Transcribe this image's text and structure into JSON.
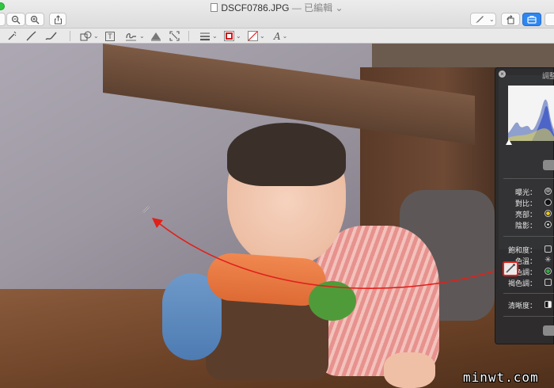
{
  "window": {
    "filename": "DSCF0786.JPG",
    "status": "— 已編輯",
    "status_caret": "⌄"
  },
  "toolbar": {
    "zoom_out_icon": "zoom-out-icon",
    "zoom_in_icon": "zoom-in-icon",
    "share_icon": "share-icon",
    "pen_icon": "pen-icon",
    "rotate_icon": "rotate-icon",
    "markup_toolbox_icon": "toolbox-icon",
    "caret": "⌄"
  },
  "markup": {
    "tools": [
      "select-icon",
      "sketch-icon",
      "draw-icon",
      "shapes-icon",
      "text-icon",
      "sign-icon",
      "adjust-color-icon",
      "adjust-size-icon",
      "line-style-icon",
      "border-color-icon",
      "fill-color-icon",
      "text-style-icon"
    ],
    "caret": "⌄",
    "text_tool_glyph": "T",
    "text_style_glyph": "A",
    "border_color": "#cc1b1b"
  },
  "panel": {
    "title": "調整顏",
    "close_glyph": "×",
    "light_rows": [
      {
        "label": "曝光：",
        "control": "reset-icon"
      },
      {
        "label": "對比：",
        "control": "circle-dark"
      },
      {
        "label": "亮部：",
        "control": "circle-yellow"
      },
      {
        "label": "陰影：",
        "control": "circle-dot"
      }
    ],
    "color_rows": [
      {
        "label": "飽和度：",
        "control": "square-icon"
      },
      {
        "label": "色溫：",
        "control": "sun-icon"
      },
      {
        "label": "色調：",
        "control": "circle-green"
      },
      {
        "label": "褐色調：",
        "control": "square-icon"
      }
    ],
    "sharpness_label": "清晰度：",
    "colors": {
      "yellow": "#e8c81c",
      "green": "#2fae45"
    }
  },
  "watermark": "minwt.com"
}
